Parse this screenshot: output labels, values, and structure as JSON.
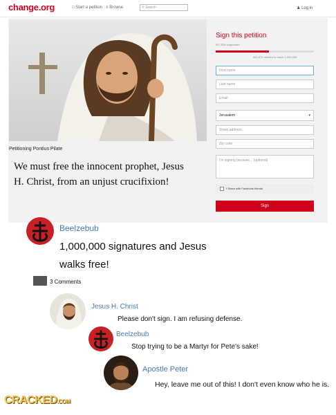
{
  "header": {
    "logo": "change.org",
    "start_petition": "Start a petition",
    "browse": "Browse",
    "search_placeholder": "Search",
    "login": "Log in"
  },
  "petition": {
    "petitioning": "Petitioning Pontius Pilate",
    "title": "We must free the innocent prophet, Jesus H. Christ, from an unjust crucifixion!"
  },
  "form": {
    "sign_title": "Sign this petition",
    "supporters": "537,528 supporters",
    "needed": "462,472 needed to reach 1,000,000",
    "progress": 0.54,
    "first_name": "First name",
    "last_name": "Last name",
    "email": "Email",
    "city": "Jerusalem",
    "street": "Street address",
    "zip": "Zip code",
    "reason": "I'm signing because... (optional)",
    "share": "Share with Facebook friends",
    "sign_button": "Sign"
  },
  "post": {
    "author": "Beelzebub",
    "text": "1,000,000 signatures and Jesus walks free!",
    "comment_count": "3 Comments"
  },
  "comments": [
    {
      "author": "Jesus H. Christ",
      "text": "Please don't sign. I am refusing defense."
    },
    {
      "author": "Beelzebub",
      "text": "Stop trying to be a Martyr for Pete's sake!"
    },
    {
      "author": "Apostle Peter",
      "text": "Hey, leave me out of this! I don't even know who he is."
    }
  ],
  "watermark": {
    "main": "CRACKED",
    "suffix": ".COM"
  },
  "colors": {
    "brand": "#d0021b",
    "name_blue": "#4a7ab5",
    "sigil_red": "#c82024"
  }
}
